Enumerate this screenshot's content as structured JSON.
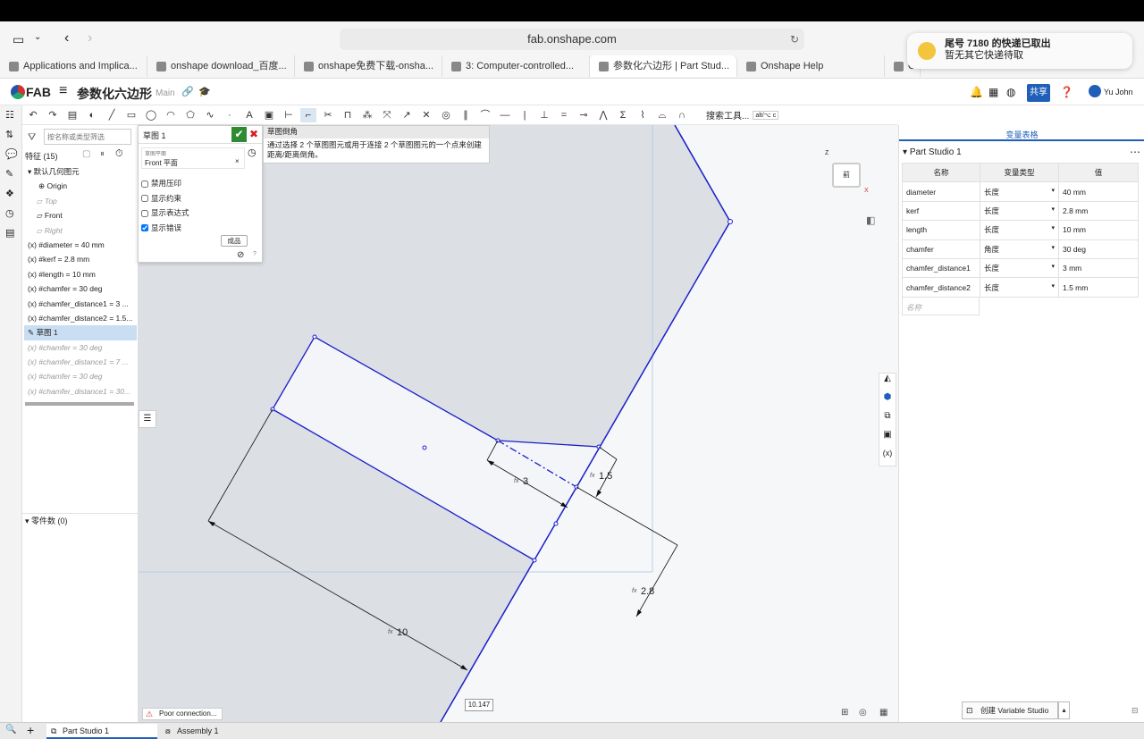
{
  "browser": {
    "url": "fab.onshape.com",
    "tabs": [
      {
        "label": "Applications and Implica..."
      },
      {
        "label": "onshape download_百度..."
      },
      {
        "label": "onshape免费下载-onsha..."
      },
      {
        "label": "3: Computer-controlled..."
      },
      {
        "label": "参数化六边形 | Part Stud..."
      },
      {
        "label": "Onshape Help"
      },
      {
        "label": "Compa"
      }
    ],
    "active_tab_index": 4
  },
  "notification": {
    "title": "尾号 7180 的快递已取出",
    "body": "暂无其它快递待取"
  },
  "app": {
    "logo": "FAB",
    "doc_title": "参数化六边形",
    "branch": "Main",
    "share_label": "共享",
    "user_name": "Yu John",
    "search_tools": "搜索工具...",
    "shortcut": "alt/⌥ c"
  },
  "left": {
    "filter_placeholder": "按名称或类型筛选",
    "features_label": "特征 (15)",
    "default_geometry": "默认几何图元",
    "geometry": [
      "Origin",
      "Top",
      "Front",
      "Right"
    ],
    "features": [
      {
        "label": "#diameter = 40 mm",
        "dim": false
      },
      {
        "label": "#kerf = 2.8 mm",
        "dim": false
      },
      {
        "label": "#length = 10 mm",
        "dim": false
      },
      {
        "label": "#chamfer = 30 deg",
        "dim": false
      },
      {
        "label": "#chamfer_distance1 = 3 ...",
        "dim": false
      },
      {
        "label": "#chamfer_distance2 = 1.5...",
        "dim": false
      },
      {
        "label": "草图 1",
        "dim": false,
        "selected": true
      },
      {
        "label": "#chamfer = 30 deg",
        "dim": true
      },
      {
        "label": "#chamfer_distance1 = 7 ...",
        "dim": true
      },
      {
        "label": "#chamfer = 30 deg",
        "dim": true
      },
      {
        "label": "#chamfer_distance1 = 30...",
        "dim": true
      }
    ],
    "parts_label": "零件数 (0)"
  },
  "sketch_dialog": {
    "title": "草图 1",
    "plane_caption": "草图平面",
    "plane_value": "Front 平面",
    "options": [
      {
        "label": "禁用压印",
        "checked": false
      },
      {
        "label": "显示约束",
        "checked": false
      },
      {
        "label": "显示表达式",
        "checked": false
      },
      {
        "label": "显示错误",
        "checked": true
      }
    ],
    "finish_label": "成品"
  },
  "tooltip": {
    "title": "草图倒角",
    "body": "通过选择 2 个草图图元或用于连接 2 个草图图元的一个点来创建距离/距离倒角。"
  },
  "viewcube": {
    "face_label": "前",
    "axis_z": "Z",
    "axis_x": "X"
  },
  "canvas": {
    "dims": [
      "3",
      "1.5",
      "2.8",
      "10"
    ],
    "fx_label": "fx",
    "coord_readout": "10.147",
    "poor_connection": "Poor connection..."
  },
  "right": {
    "panel_title": "变量表格",
    "studio_title": "Part Studio 1",
    "headers": [
      "名称",
      "变量类型",
      "值"
    ],
    "rows": [
      {
        "name": "diameter",
        "type": "长度",
        "value": "40 mm"
      },
      {
        "name": "kerf",
        "type": "长度",
        "value": "2.8 mm"
      },
      {
        "name": "length",
        "type": "长度",
        "value": "10 mm"
      },
      {
        "name": "chamfer",
        "type": "角度",
        "value": "30 deg"
      },
      {
        "name": "chamfer_distance1",
        "type": "长度",
        "value": "3 mm"
      },
      {
        "name": "chamfer_distance2",
        "type": "长度",
        "value": "1.5 mm"
      }
    ],
    "name_placeholder": "名称",
    "create_button": "创建 Variable Studio"
  },
  "bottom": {
    "tabs": [
      "Part Studio 1",
      "Assembly 1"
    ]
  },
  "colors": {
    "accent": "#1f5fb8",
    "sketch": "#1a1fc8",
    "region": "#dcdfe4",
    "ok": "#2e8b32",
    "cancel": "#d42020"
  }
}
